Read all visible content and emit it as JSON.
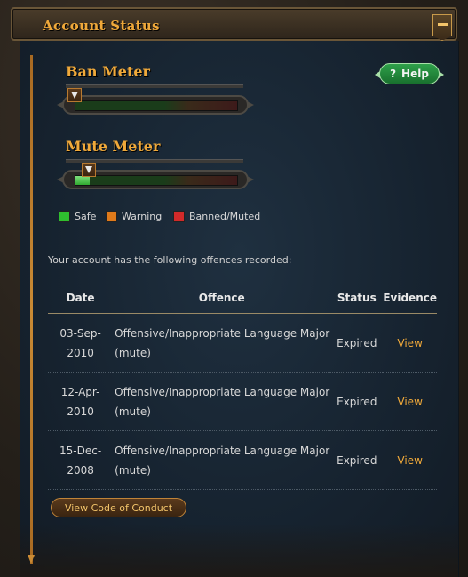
{
  "header": {
    "title": "Account Status",
    "minimize_icon": "minus-icon"
  },
  "help": {
    "label": "Help",
    "icon_glyph": "?"
  },
  "meters": {
    "ban": {
      "title": "Ban Meter",
      "level": 0.0
    },
    "mute": {
      "title": "Mute Meter",
      "level": 0.09
    }
  },
  "legend": [
    {
      "label": "Safe",
      "color": "#2fbf2f"
    },
    {
      "label": "Warning",
      "color": "#e07a1a"
    },
    {
      "label": "Banned/Muted",
      "color": "#d12a2a"
    }
  ],
  "intro": "Your account has the following offences recorded:",
  "table": {
    "headers": [
      "Date",
      "Offence",
      "Status",
      "Evidence"
    ],
    "rows": [
      {
        "date_1": "03-Sep-",
        "date_2": "2010",
        "offence_1": "Offensive/Inappropriate Language Major",
        "offence_2": "(mute)",
        "status": "Expired",
        "evidence": "View"
      },
      {
        "date_1": "12-Apr-2010",
        "date_2": "",
        "offence_1": "Offensive/Inappropriate Language Major",
        "offence_2": "(mute)",
        "status": "Expired",
        "evidence": "View"
      },
      {
        "date_1": "15-Dec-",
        "date_2": "2008",
        "offence_1": "Offensive/Inappropriate Language Major",
        "offence_2": "(mute)",
        "status": "Expired",
        "evidence": "View"
      }
    ]
  },
  "coc_button": "View Code of Conduct",
  "colors": {
    "accent": "#f0a93a",
    "panel": "#172431",
    "help_green": "#2fa04a"
  }
}
